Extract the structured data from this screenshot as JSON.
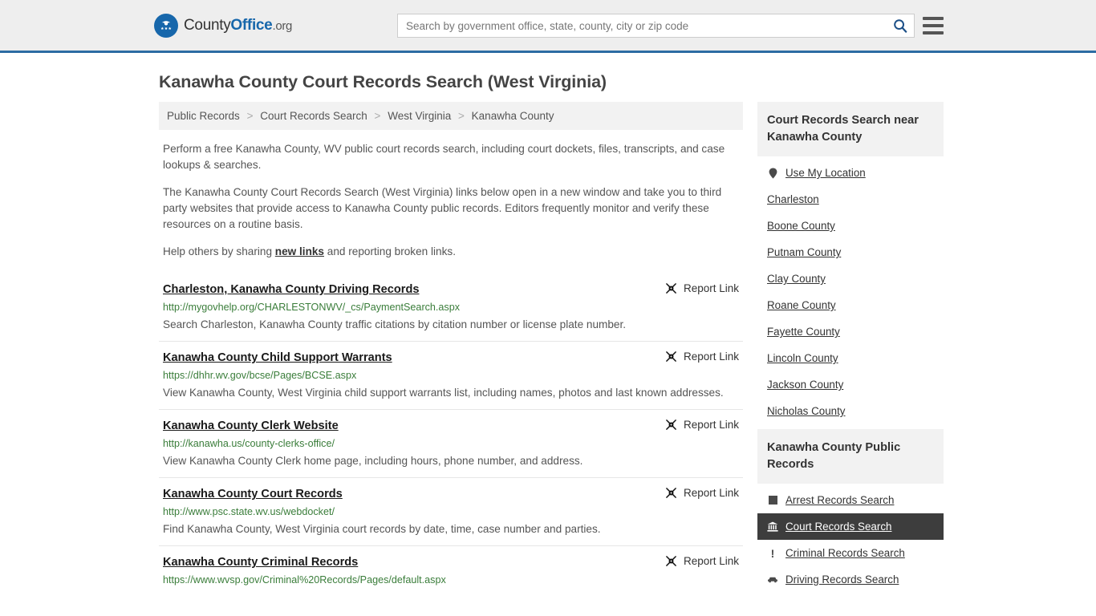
{
  "header": {
    "logo": {
      "part1": "County",
      "part2": "Office",
      "part3": ".org",
      "icon": "eagle-seal-icon"
    },
    "search": {
      "placeholder": "Search by government office, state, county, city or zip code",
      "value": "",
      "icon": "search-icon"
    },
    "menu_icon": "hamburger-menu-icon",
    "accent_color": "#2c6ca3",
    "background_color": "#eeeeee"
  },
  "page": {
    "title": "Kanawha County Court Records Search (West Virginia)"
  },
  "breadcrumb": {
    "separator": ">",
    "items": [
      {
        "label": "Public Records"
      },
      {
        "label": "Court Records Search"
      },
      {
        "label": "West Virginia"
      },
      {
        "label": "Kanawha County"
      }
    ]
  },
  "intro": {
    "p1": "Perform a free Kanawha County, WV public court records search, including court dockets, files, transcripts, and case lookups & searches.",
    "p2": "The Kanawha County Court Records Search (West Virginia) links below open in a new window and take you to third party websites that provide access to Kanawha County public records. Editors frequently monitor and verify these resources on a routine basis.",
    "p3_before": "Help others by sharing ",
    "p3_link": "new links",
    "p3_after": " and reporting broken links."
  },
  "results": {
    "report_label": "Report Link",
    "report_icon": "broken-link-icon",
    "items": [
      {
        "title": "Charleston, Kanawha County Driving Records",
        "url": "http://mygovhelp.org/CHARLESTONWV/_cs/PaymentSearch.aspx",
        "description": "Search Charleston, Kanawha County traffic citations by citation number or license plate number."
      },
      {
        "title": "Kanawha County Child Support Warrants",
        "url": "https://dhhr.wv.gov/bcse/Pages/BCSE.aspx",
        "description": "View Kanawha County, West Virginia child support warrants list, including names, photos and last known addresses."
      },
      {
        "title": "Kanawha County Clerk Website",
        "url": "http://kanawha.us/county-clerks-office/",
        "description": "View Kanawha County Clerk home page, including hours, phone number, and address."
      },
      {
        "title": "Kanawha County Court Records",
        "url": "http://www.psc.state.wv.us/webdocket/",
        "description": "Find Kanawha County, West Virginia court records by date, time, case number and parties."
      },
      {
        "title": "Kanawha County Criminal Records",
        "url": "https://www.wvsp.gov/Criminal%20Records/Pages/default.aspx",
        "description": ""
      }
    ]
  },
  "sidebar": {
    "nearby": {
      "heading": "Court Records Search near Kanawha County",
      "items": [
        {
          "label": "Use My Location",
          "icon": "map-pin-icon"
        },
        {
          "label": "Charleston",
          "icon": ""
        },
        {
          "label": "Boone County",
          "icon": ""
        },
        {
          "label": "Putnam County",
          "icon": ""
        },
        {
          "label": "Clay County",
          "icon": ""
        },
        {
          "label": "Roane County",
          "icon": ""
        },
        {
          "label": "Fayette County",
          "icon": ""
        },
        {
          "label": "Lincoln County",
          "icon": ""
        },
        {
          "label": "Jackson County",
          "icon": ""
        },
        {
          "label": "Nicholas County",
          "icon": ""
        }
      ]
    },
    "public_records": {
      "heading": "Kanawha County Public Records",
      "active_label": "Court Records Search",
      "items": [
        {
          "label": "Arrest Records Search",
          "icon": "square-icon",
          "active": false
        },
        {
          "label": "Court Records Search",
          "icon": "courthouse-icon",
          "active": true
        },
        {
          "label": "Criminal Records Search",
          "icon": "exclamation-icon",
          "active": false
        },
        {
          "label": "Driving Records Search",
          "icon": "car-icon",
          "active": false
        }
      ]
    }
  }
}
